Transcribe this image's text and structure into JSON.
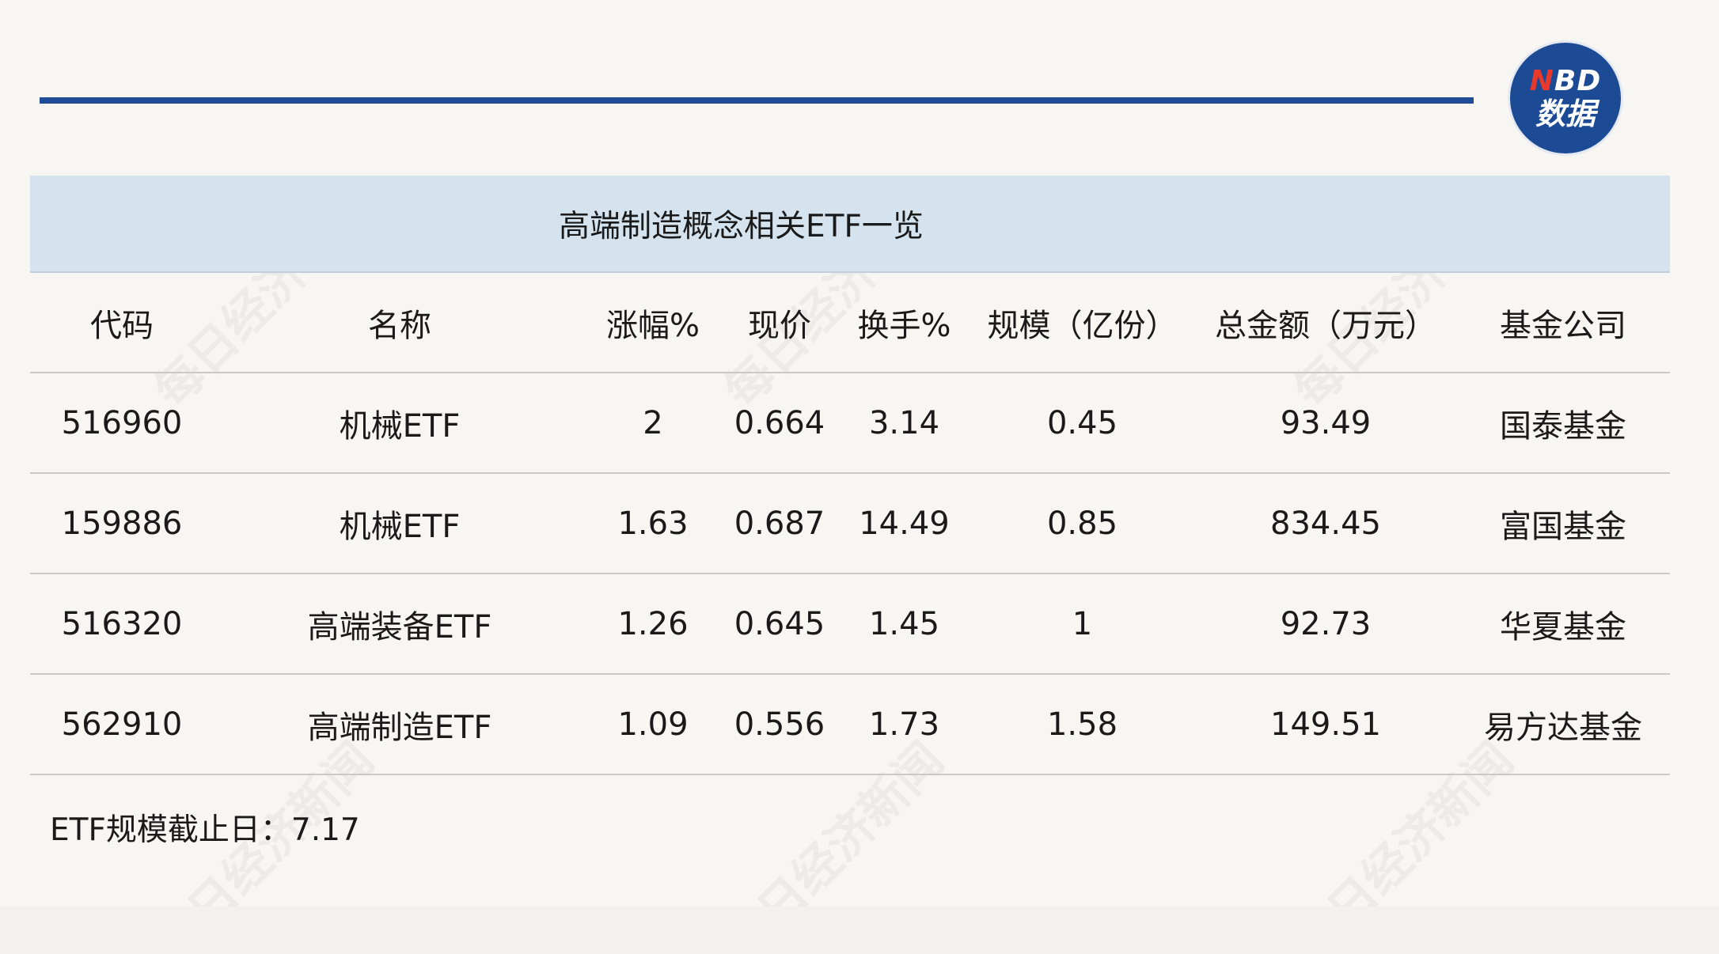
{
  "title": "高端制造概念相关ETF一览",
  "logo": {
    "nbd_n": "N",
    "nbd_rest": "BD",
    "data_label": "数据"
  },
  "watermark_text": "每日经济新闻",
  "table": {
    "headers": [
      "代码",
      "名称",
      "涨幅%",
      "现价",
      "换手%",
      "规模（亿份）",
      "总金额（万元）",
      "基金公司"
    ],
    "rows": [
      [
        "516960",
        "机械ETF",
        "2",
        "0.664",
        "3.14",
        "0.45",
        "93.49",
        "国泰基金"
      ],
      [
        "159886",
        "机械ETF",
        "1.63",
        "0.687",
        "14.49",
        "0.85",
        "834.45",
        "富国基金"
      ],
      [
        "516320",
        "高端装备ETF",
        "1.26",
        "0.645",
        "1.45",
        "1",
        "92.73",
        "华夏基金"
      ],
      [
        "562910",
        "高端制造ETF",
        "1.09",
        "0.556",
        "1.73",
        "1.58",
        "149.51",
        "易方达基金"
      ]
    ]
  },
  "note": "ETF规模截止日：7.17",
  "colors": {
    "accent_rule": "#1f4e96",
    "logo_bg": "#1c4a94",
    "logo_n": "#e8392d",
    "title_band": "#d5e3ef",
    "background": "#f8f6f2"
  }
}
